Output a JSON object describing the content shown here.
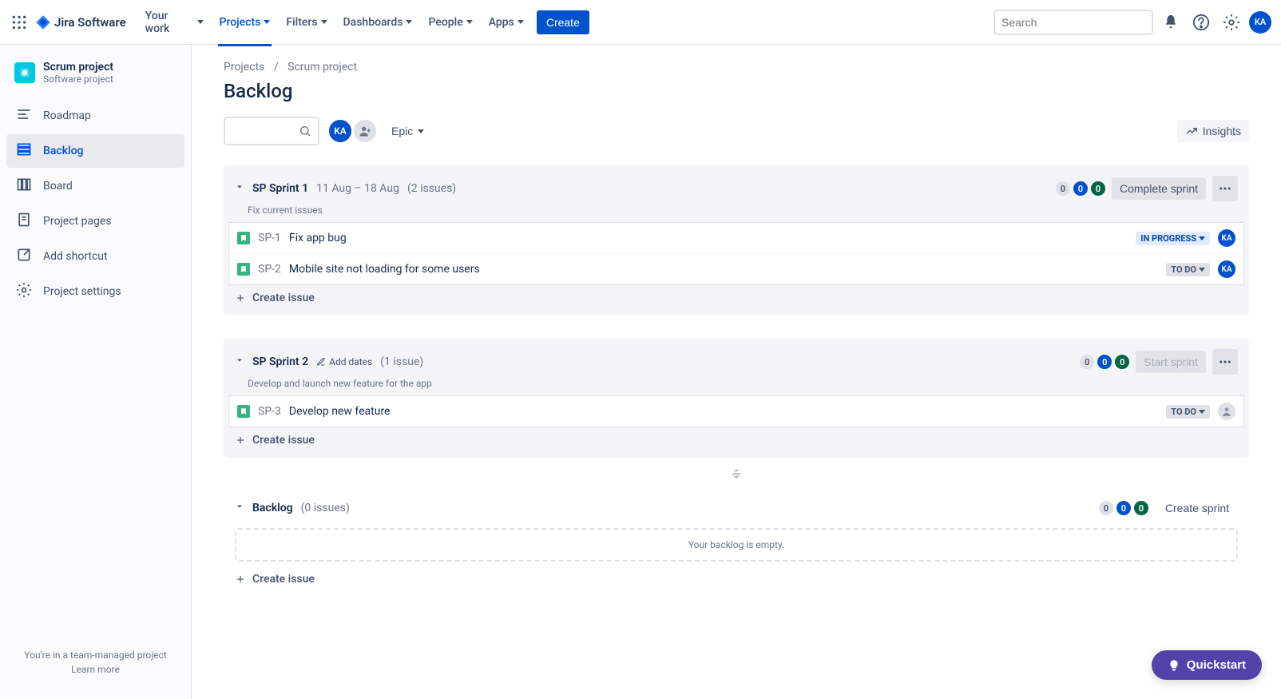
{
  "topnav": {
    "logo": "Jira Software",
    "items": [
      "Your work",
      "Projects",
      "Filters",
      "Dashboards",
      "People",
      "Apps"
    ],
    "active_index": 1,
    "create": "Create",
    "search_placeholder": "Search"
  },
  "user_initials": "KA",
  "sidebar": {
    "project_name": "Scrum project",
    "project_type": "Software project",
    "items": [
      {
        "label": "Roadmap"
      },
      {
        "label": "Backlog"
      },
      {
        "label": "Board"
      },
      {
        "label": "Project pages"
      },
      {
        "label": "Add shortcut"
      },
      {
        "label": "Project settings"
      }
    ],
    "active_index": 1,
    "footer_line1": "You're in a team-managed project",
    "footer_link": "Learn more"
  },
  "breadcrumb": [
    "Projects",
    "Scrum project"
  ],
  "page_title": "Backlog",
  "toolbar": {
    "epic_label": "Epic",
    "insights_label": "Insights"
  },
  "sprints": [
    {
      "name": "SP Sprint 1",
      "dates": "11 Aug – 18 Aug",
      "issue_count": "(2 issues)",
      "goal": "Fix current issues",
      "badges": [
        "0",
        "0",
        "0"
      ],
      "action": "Complete sprint",
      "action_disabled": false,
      "has_dates": true,
      "issues": [
        {
          "key": "SP-1",
          "summary": "Fix app bug",
          "status": "IN PROGRESS",
          "status_class": "inprogress",
          "assignee": "KA"
        },
        {
          "key": "SP-2",
          "summary": "Mobile site not loading for some users",
          "status": "TO DO",
          "status_class": "todo",
          "assignee": "KA"
        }
      ]
    },
    {
      "name": "SP Sprint 2",
      "add_dates_label": "Add dates",
      "issue_count": "(1 issue)",
      "goal": "Develop and launch new feature for the app",
      "badges": [
        "0",
        "0",
        "0"
      ],
      "action": "Start sprint",
      "action_disabled": true,
      "has_dates": false,
      "issues": [
        {
          "key": "SP-3",
          "summary": "Develop new feature",
          "status": "TO DO",
          "status_class": "todo",
          "assignee": null
        }
      ]
    }
  ],
  "create_issue_label": "Create issue",
  "backlog": {
    "title": "Backlog",
    "count": "(0 issues)",
    "badges": [
      "0",
      "0",
      "0"
    ],
    "action": "Create sprint",
    "empty_text": "Your backlog is empty."
  },
  "quickstart": "Quickstart"
}
